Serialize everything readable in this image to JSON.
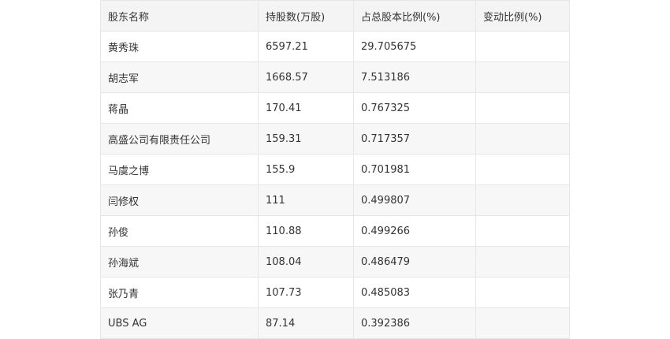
{
  "table": {
    "headers": [
      "股东名称",
      "持股数(万股)",
      "占总股本比例(%)",
      "变动比例(%)"
    ],
    "rows": [
      [
        "黄秀珠",
        "6597.21",
        "29.705675",
        ""
      ],
      [
        "胡志军",
        "1668.57",
        "7.513186",
        ""
      ],
      [
        "蒋晶",
        "170.41",
        "0.767325",
        ""
      ],
      [
        "高盛公司有限责任公司",
        "159.31",
        "0.717357",
        ""
      ],
      [
        "马虞之博",
        "155.9",
        "0.701981",
        ""
      ],
      [
        "闫修权",
        "111",
        "0.499807",
        ""
      ],
      [
        "孙俊",
        "110.88",
        "0.499266",
        ""
      ],
      [
        "孙海斌",
        "108.04",
        "0.486479",
        ""
      ],
      [
        "张乃青",
        "107.73",
        "0.485083",
        ""
      ],
      [
        "UBS AG",
        "87.14",
        "0.392386",
        ""
      ]
    ]
  }
}
